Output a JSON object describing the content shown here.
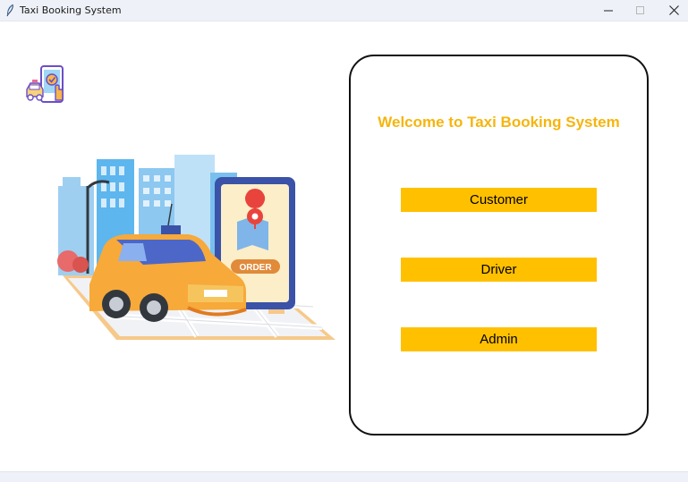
{
  "window": {
    "title": "Taxi Booking System",
    "controls": {
      "minimize_icon": "minimize-icon",
      "maximize_icon": "maximize-icon",
      "close_icon": "close-icon"
    }
  },
  "main": {
    "logo_icon": "taxi-booking-app-logo-icon",
    "illustration": "taxi-order-illustration",
    "panel": {
      "welcome_text": "Welcome to Taxi Booking System",
      "buttons": [
        {
          "label": "Customer"
        },
        {
          "label": "Driver"
        },
        {
          "label": "Admin"
        }
      ]
    }
  },
  "colors": {
    "accent": "#ffc000",
    "welcome_text": "#f6b50d",
    "panel_border": "#111111",
    "background": "#ffffff"
  }
}
